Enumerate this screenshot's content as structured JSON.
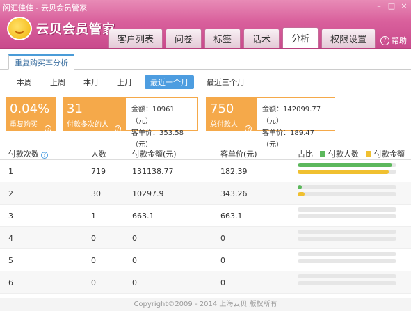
{
  "window": {
    "title": "阁汇佳佳 - 云贝会员管家",
    "minimize": "–",
    "maximize": "□",
    "close": "×"
  },
  "app": {
    "name": "云贝会员管家"
  },
  "tabs": [
    {
      "label": "客户列表"
    },
    {
      "label": "问卷"
    },
    {
      "label": "标签"
    },
    {
      "label": "话术"
    },
    {
      "label": "分析",
      "active": true
    },
    {
      "label": "权限设置"
    }
  ],
  "help": {
    "label": "帮助",
    "icon": "?"
  },
  "subtab": {
    "label": "重复购买率分析"
  },
  "periods": [
    {
      "label": "本周"
    },
    {
      "label": "上周"
    },
    {
      "label": "本月"
    },
    {
      "label": "上月"
    },
    {
      "label": "最近一个月",
      "active": true
    },
    {
      "label": "最近三个月"
    }
  ],
  "cards": {
    "rate": {
      "value": "0.04%",
      "label": "重复购买率"
    },
    "repeat": {
      "value": "31",
      "label": "付款多次的人数",
      "amount": "金额：10961（元）",
      "avg": "客单价：353.58（元）"
    },
    "total": {
      "value": "750",
      "label": "总付款人数",
      "amount": "金额：142099.77（元）",
      "avg": "客单价：189.47（元）"
    }
  },
  "table": {
    "headers": {
      "times": "付款次数",
      "people": "人数",
      "amount": "付款金额(元)",
      "avg": "客单价(元)",
      "ratio": "占比"
    },
    "legend": [
      {
        "label": "付款人数",
        "color": "#5cb85c"
      },
      {
        "label": "付款金额",
        "color": "#f0c030"
      }
    ],
    "rows": [
      {
        "times": "1",
        "people": "719",
        "amount": "131138.77",
        "avg": "182.39",
        "people_pct": 0.958,
        "amount_pct": 0.923
      },
      {
        "times": "2",
        "people": "30",
        "amount": "10297.9",
        "avg": "343.26",
        "people_pct": 0.04,
        "amount_pct": 0.072
      },
      {
        "times": "3",
        "people": "1",
        "amount": "663.1",
        "avg": "663.1",
        "people_pct": 0.0013,
        "amount_pct": 0.0047
      },
      {
        "times": "4",
        "people": "0",
        "amount": "0",
        "avg": "0",
        "people_pct": 0,
        "amount_pct": 0
      },
      {
        "times": "5",
        "people": "0",
        "amount": "0",
        "avg": "0",
        "people_pct": 0,
        "amount_pct": 0
      },
      {
        "times": "6",
        "people": "0",
        "amount": "0",
        "avg": "0",
        "people_pct": 0,
        "amount_pct": 0
      }
    ]
  },
  "footer": {
    "text": "Copyright©2009 - 2014 上海云贝 版权所有"
  }
}
